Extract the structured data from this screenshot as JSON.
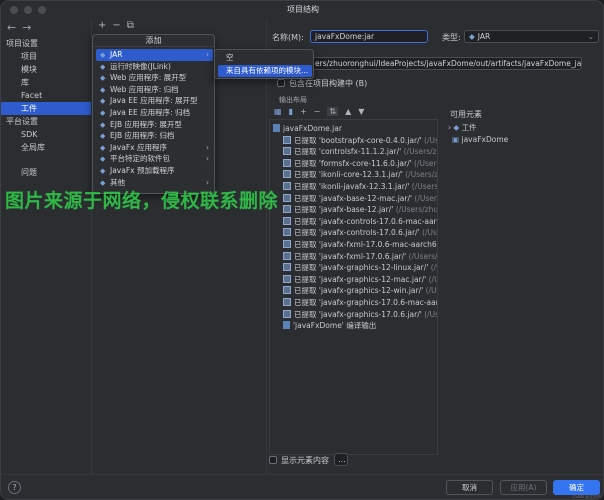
{
  "window": {
    "title": "项目结构"
  },
  "nav": {
    "back": "←",
    "forward": "→"
  },
  "sidebar": {
    "sections": [
      {
        "label": "项目设置",
        "items": [
          "项目",
          "模块",
          "库",
          "Facet",
          "工件"
        ]
      },
      {
        "label": "平台设置",
        "items": [
          "SDK",
          "全局库"
        ]
      }
    ],
    "extra": "问题",
    "selected": "工件"
  },
  "middle_toolbar": {
    "add": "+",
    "remove": "−",
    "copy": "⧉"
  },
  "add_menu": {
    "title": "添加",
    "items": [
      {
        "icon": "artifact-icon",
        "label": "JAR",
        "submenu": true,
        "selected": true
      },
      {
        "icon": "artifact-icon",
        "label": "运行时映像(JLink)",
        "submenu": false
      },
      {
        "icon": "artifact-icon",
        "label": "Web 应用程序: 展开型",
        "submenu": false
      },
      {
        "icon": "artifact-icon",
        "label": "Web 应用程序: 归档",
        "submenu": false
      },
      {
        "icon": "artifact-icon",
        "label": "Java EE 应用程序: 展开型",
        "submenu": false
      },
      {
        "icon": "artifact-icon",
        "label": "Java EE 应用程序: 归档",
        "submenu": false
      },
      {
        "icon": "artifact-icon",
        "label": "EJB 应用程序: 展开型",
        "submenu": false
      },
      {
        "icon": "artifact-icon",
        "label": "EJB 应用程序: 归档",
        "submenu": false
      },
      {
        "icon": "artifact-icon",
        "label": "JavaFx 应用程序",
        "submenu": true
      },
      {
        "icon": "artifact-icon",
        "label": "平台特定的软件包",
        "submenu": true
      },
      {
        "icon": "artifact-icon",
        "label": "JavaFx 预加载程序",
        "submenu": false
      },
      {
        "icon": "artifact-icon",
        "label": "其他",
        "submenu": true
      }
    ]
  },
  "jar_submenu": {
    "items": [
      {
        "label": "空",
        "selected": false
      },
      {
        "label": "来自具有依赖项的模块...",
        "selected": true
      }
    ]
  },
  "artifact": {
    "name_label": "名称(M):",
    "name_value": "javaFxDome:jar",
    "type_label": "类型:",
    "type_value": "JAR",
    "output_path": "ers/zhuoronghui/IdeaProjects/javaFxDome/out/artifacts/javaFxDome_jar",
    "build_checkbox_label": "包含在项目构建中 (B)",
    "output_layout_label": "输出布局",
    "available_label": "可用元素",
    "show_content_label": "显示元素内容",
    "more_button": "..."
  },
  "layout_toolbar": [
    "folder-icon",
    "archive-icon",
    "+",
    "−",
    "sort-icon",
    "▲",
    "▼"
  ],
  "output_tree": [
    {
      "kind": "jar",
      "text": "javaFxDome.jar",
      "dim": ""
    },
    {
      "kind": "lib",
      "text": "已提取 'bootstrapfx-core-0.4.0.jar/'",
      "dim": " (/Us"
    },
    {
      "kind": "lib",
      "text": "已提取 'controlsfx-11.1.2.jar/'",
      "dim": " (/Users/zhu"
    },
    {
      "kind": "lib",
      "text": "已提取 'formsfx-core-11.6.0.jar/'",
      "dim": " (/Users/"
    },
    {
      "kind": "lib",
      "text": "已提取 'ikonli-core-12.3.1.jar/'",
      "dim": " (/Users/zh"
    },
    {
      "kind": "lib",
      "text": "已提取 'ikonli-javafx-12.3.1.jar/'",
      "dim": " (/Users/z"
    },
    {
      "kind": "lib",
      "text": "已提取 'javafx-base-12-mac.jar/'",
      "dim": " (/Users/"
    },
    {
      "kind": "lib",
      "text": "已提取 'javafx-base-12.jar/'",
      "dim": " (/Users/zhuo"
    },
    {
      "kind": "lib",
      "text": "已提取 'javafx-controls-17.0.6-mac-aarch",
      "dim": ""
    },
    {
      "kind": "lib",
      "text": "已提取 'javafx-controls-17.0.6.jar/'",
      "dim": " (/Use"
    },
    {
      "kind": "lib",
      "text": "已提取 'javafx-fxml-17.0.6-mac-aarch64",
      "dim": ""
    },
    {
      "kind": "lib",
      "text": "已提取 'javafx-fxml-17.0.6.jar/'",
      "dim": " (/Users/"
    },
    {
      "kind": "lib",
      "text": "已提取 'javafx-graphics-12-linux.jar/'",
      "dim": " (/U"
    },
    {
      "kind": "lib",
      "text": "已提取 'javafx-graphics-12-mac.jar/'",
      "dim": " (/Us"
    },
    {
      "kind": "lib",
      "text": "已提取 'javafx-graphics-12-win.jar/'",
      "dim": " (/Us"
    },
    {
      "kind": "lib",
      "text": "已提取 'javafx-graphics-17.0.6-mac-aarc",
      "dim": ""
    },
    {
      "kind": "lib",
      "text": "已提取 'javafx-graphics-17.0.6.jar/'",
      "dim": " (/Use"
    },
    {
      "kind": "jar",
      "text": "'javaFxDome' 编译输出",
      "dim": ""
    }
  ],
  "available_tree": [
    {
      "text": "工件",
      "expander": "›"
    },
    {
      "text": "javaFxDome",
      "expander": ""
    }
  ],
  "watermark": "图片来源于网络，侵权联系删除",
  "footer": {
    "help": "?",
    "cancel": "取消",
    "apply": "应用(A)",
    "ok": "确定",
    "credit": "CSDN @北木桥"
  },
  "colors": {
    "accent": "#2e5ccf",
    "primary_button": "#3574f0",
    "watermark": "#2fd14a"
  }
}
